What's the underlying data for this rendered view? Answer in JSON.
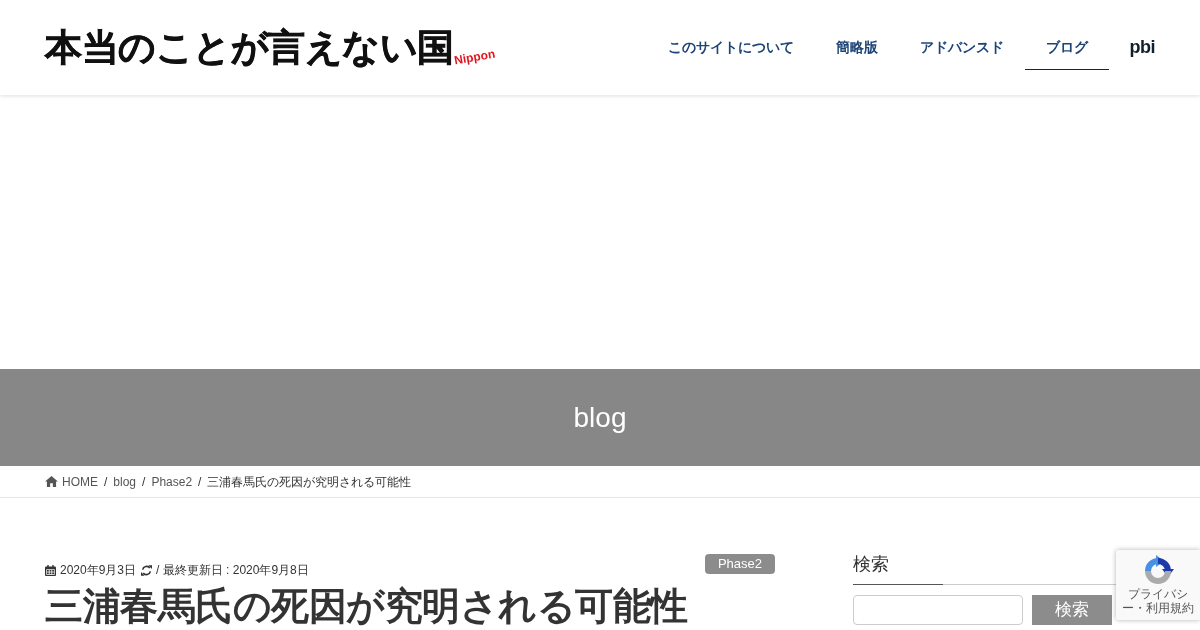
{
  "header": {
    "logo": {
      "title": "本当のことが言えない国",
      "tag": "Nippon"
    },
    "nav": [
      {
        "kind": "text",
        "label": "このサイトについて",
        "selected": false
      },
      {
        "kind": "text",
        "label": "簡略版",
        "selected": false
      },
      {
        "kind": "text",
        "label": "アドバンスド",
        "selected": false
      },
      {
        "kind": "text",
        "label": "ブログ",
        "selected": true
      },
      {
        "kind": "logo",
        "label": "pbi",
        "selected": false
      }
    ]
  },
  "page_header": {
    "title": "blog"
  },
  "breadcrumb": [
    {
      "kind": "home",
      "text": "HOME"
    },
    {
      "kind": "separator",
      "text": "/"
    },
    {
      "kind": "link",
      "text": "blog"
    },
    {
      "kind": "separator",
      "text": "/"
    },
    {
      "kind": "link",
      "text": "Phase2"
    },
    {
      "kind": "separator",
      "text": "/"
    },
    {
      "kind": "current",
      "text": "三浦春馬氏の死因が究明される可能性"
    }
  ],
  "post": {
    "published": "2020年9月3日",
    "updated": "/ 最終更新日 : 2020年9月8日",
    "category": "Phase2",
    "title": "三浦春馬氏の死因が究明される可能性"
  },
  "sidebar": {
    "search": {
      "heading": "検索",
      "button": "検索"
    }
  },
  "recaptcha": {
    "links": "プライバシー・利用規約"
  }
}
